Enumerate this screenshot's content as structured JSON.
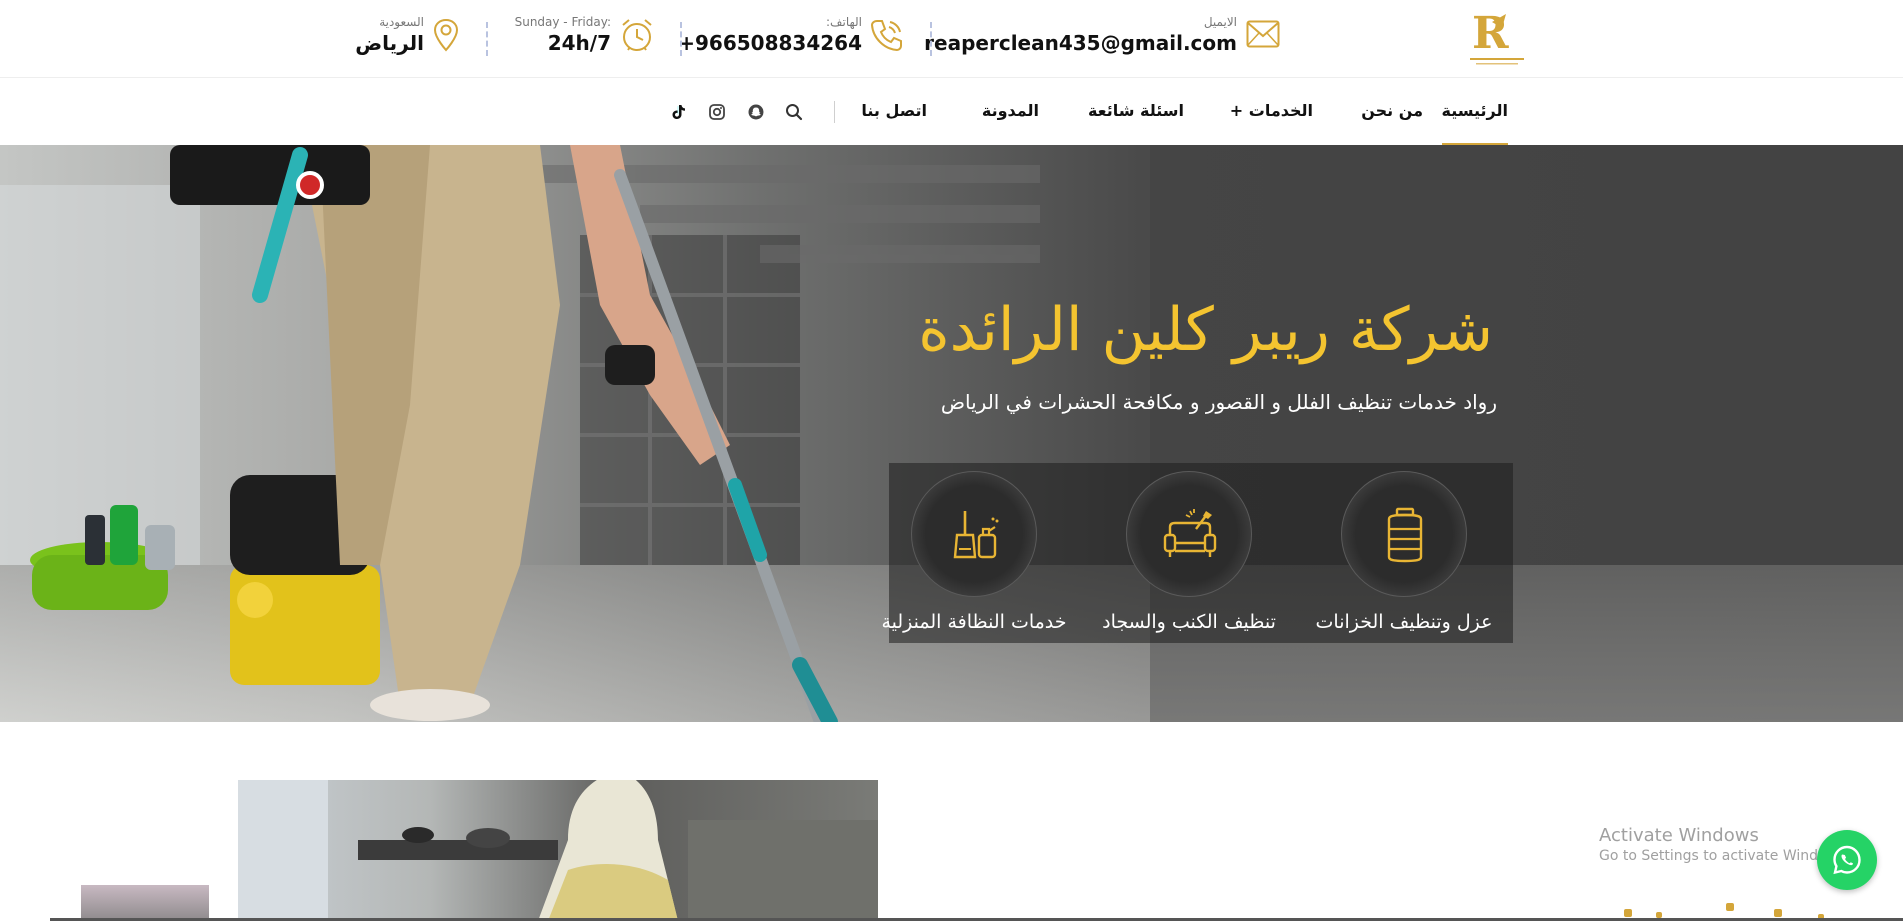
{
  "brand": {
    "name": "Reaper Clean",
    "accent": "#f4c430",
    "gold": "#d4a63a"
  },
  "topbar": {
    "email": {
      "label": "الايميل",
      "value": "reaperclean435@gmail.com",
      "icon": "envelope-icon"
    },
    "phone": {
      "label": "الهاتف:",
      "value": "+966508834264",
      "icon": "phone-icon"
    },
    "hours": {
      "label": "Sunday - Friday:",
      "value": "24h/7",
      "icon": "alarm-clock-icon"
    },
    "location": {
      "label": "السعودية",
      "value": "الرياض",
      "icon": "map-pin-icon"
    }
  },
  "nav": {
    "items": [
      {
        "label": "الرئيسية",
        "active": true
      },
      {
        "label": "من نحن"
      },
      {
        "label": "الخدمات +"
      },
      {
        "label": "اسئلة شائعة"
      },
      {
        "label": "المدونة"
      },
      {
        "label": "اتصل بنا"
      }
    ],
    "icons": [
      "search-icon",
      "snapchat-icon",
      "instagram-icon",
      "tiktok-icon"
    ]
  },
  "hero": {
    "title": "شركة ريبر كلين الرائدة",
    "subtitle": "رواد خدمات تنظيف الفلل و القصور و مكافحة الحشرات في الرياض",
    "services": [
      {
        "label": "عزل وتنظيف الخزانات",
        "icon": "water-tank-icon"
      },
      {
        "label": "تنظيف الكنب والسجاد",
        "icon": "sofa-icon"
      },
      {
        "label": "خدمات النظافة المنزلية",
        "icon": "cleaning-tools-icon"
      }
    ]
  },
  "overlay": {
    "activate_title": "Activate Windows",
    "activate_sub": "Go to Settings to activate Windows."
  }
}
